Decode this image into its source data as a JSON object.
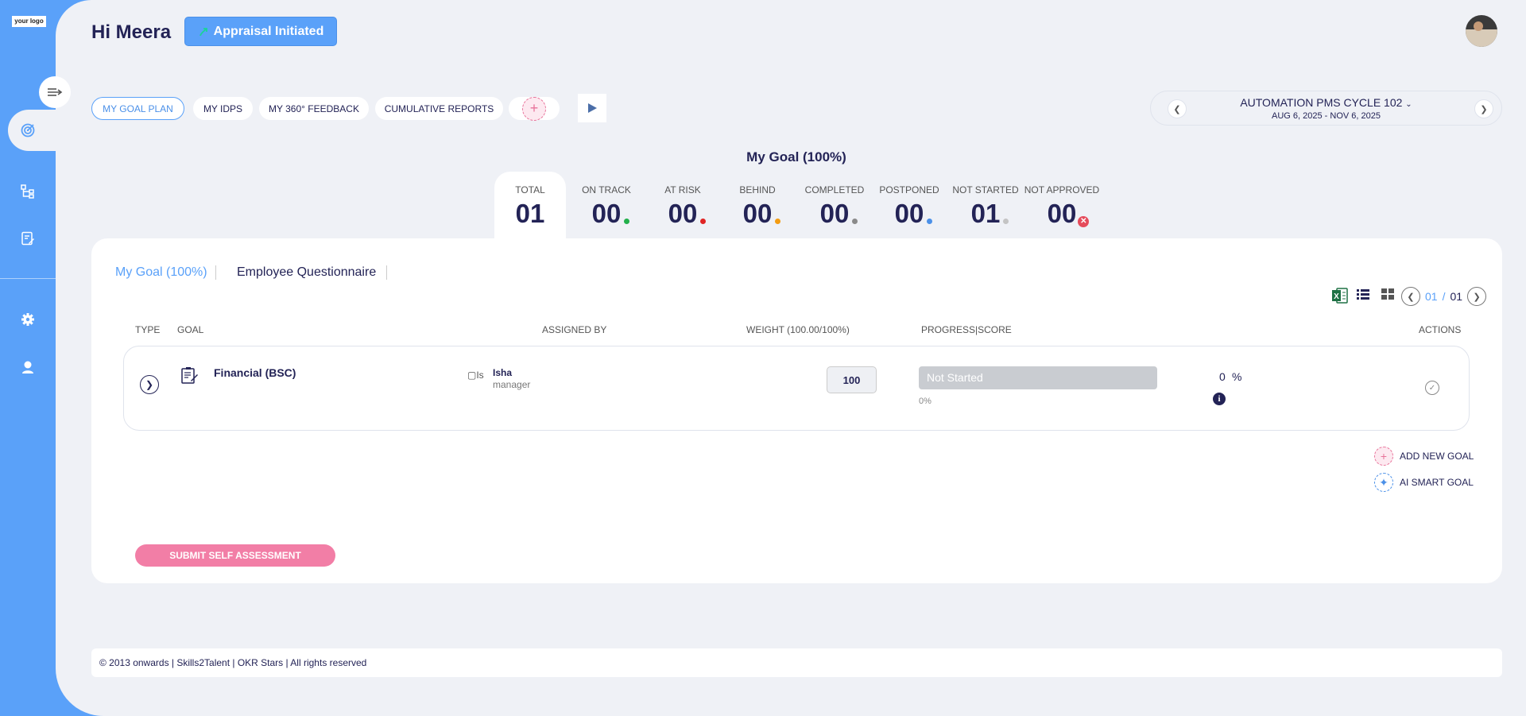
{
  "logo": {
    "text": "your logo"
  },
  "header": {
    "greeting": "Hi Meera",
    "appraisal_badge": "Appraisal Initiated"
  },
  "tabs": [
    {
      "label": "MY GOAL PLAN",
      "active": true
    },
    {
      "label": "MY IDPS",
      "active": false
    },
    {
      "label": "MY 360° FEEDBACK",
      "active": false
    },
    {
      "label": "CUMULATIVE REPORTS",
      "active": false
    }
  ],
  "cycle": {
    "title": "AUTOMATION PMS CYCLE 102",
    "dates": "AUG 6, 2025 - NOV 6, 2025"
  },
  "goal_heading": "My Goal (100%)",
  "stats": [
    {
      "label": "TOTAL",
      "value": "01"
    },
    {
      "label": "ON TRACK",
      "value": "00",
      "color": "#22b04b"
    },
    {
      "label": "AT RISK",
      "value": "00",
      "color": "#e02424"
    },
    {
      "label": "BEHIND",
      "value": "00",
      "color": "#f39c12"
    },
    {
      "label": "COMPLETED",
      "value": "00",
      "color": "#8a8a8a"
    },
    {
      "label": "POSTPONED",
      "value": "00",
      "color": "#4b90e8"
    },
    {
      "label": "NOT STARTED",
      "value": "01",
      "color": "#c4c4c4"
    },
    {
      "label": "NOT APPROVED",
      "value": "00",
      "color": "#e54b5b"
    }
  ],
  "subtabs": [
    {
      "label": "My Goal (100%)",
      "active": true
    },
    {
      "label": "Employee Questionnaire",
      "active": false
    }
  ],
  "pager": {
    "current": "01",
    "separator": "/",
    "total": "01"
  },
  "columns": {
    "type": "TYPE",
    "goal": "GOAL",
    "assigned_by": "ASSIGNED BY",
    "weight": "WEIGHT (100.00/100%)",
    "progress": "PROGRESS|SCORE",
    "actions": "ACTIONS"
  },
  "goal_rows": [
    {
      "name": "Financial (BSC)",
      "assignee_img_alt": "Is",
      "assignee_name": "Isha",
      "assignee_role": "manager",
      "weight": "100",
      "status": "Not Started",
      "progress": 0,
      "progress_label": "0%",
      "score": "0",
      "score_unit": "%"
    }
  ],
  "actions": {
    "add_goal": "ADD NEW GOAL",
    "ai_goal": "AI SMART GOAL",
    "submit": "SUBMIT SELF ASSESSMENT"
  },
  "footer": "© 2013 onwards | Skills2Talent | OKR Stars | All rights reserved"
}
